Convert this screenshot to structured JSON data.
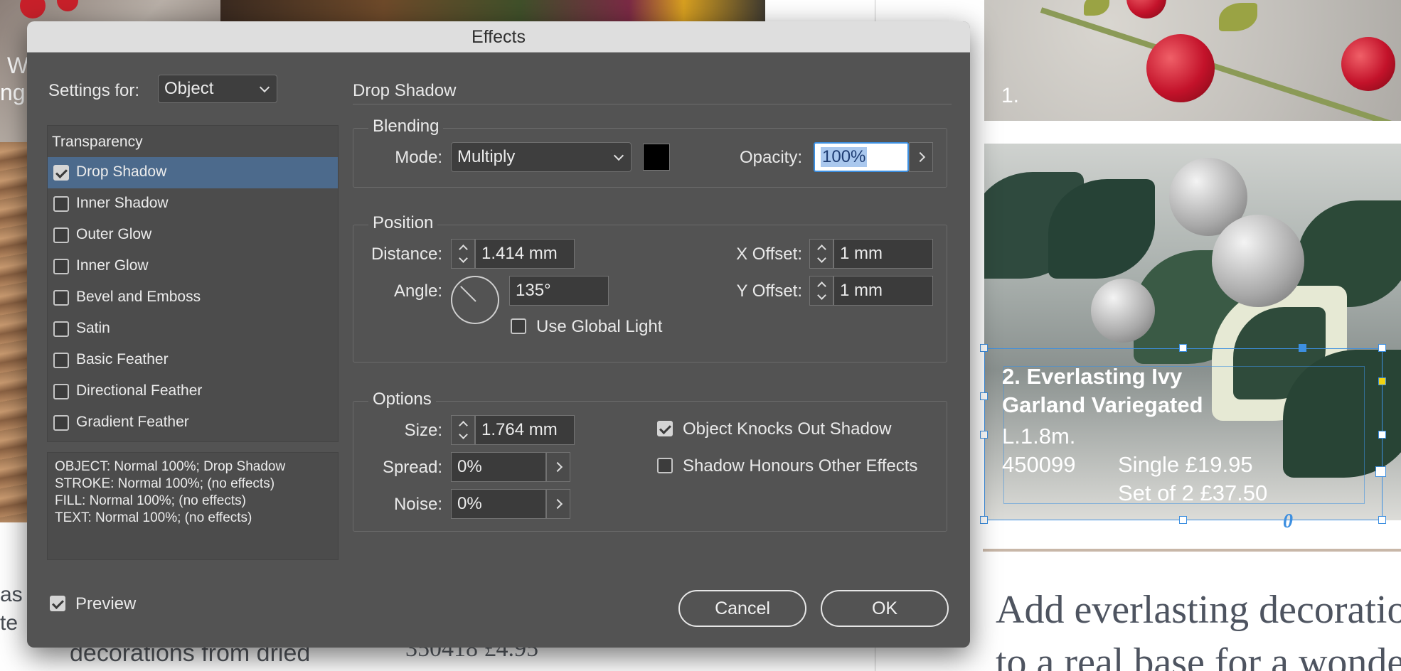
{
  "background": {
    "left_text_1": "W",
    "left_text_2": "ng",
    "left_text_3": "as",
    "left_text_4": "te",
    "bottom_left_text": "decorations from dried",
    "bottom_mid_text": "350418 £4.95",
    "top_photo_number": "1.",
    "frame_title_1": "2. Everlasting Ivy",
    "frame_title_2": "Garland Variegated",
    "frame_size": "L.1.8m.",
    "frame_code": "450099",
    "frame_price_single": "Single £19.95",
    "frame_price_set": "Set of 2 £37.50",
    "body_line_1": "Add everlasting decoratio",
    "body_line_2": "to a real base for a wonde"
  },
  "dialog": {
    "title": "Effects",
    "settings_for_label": "Settings for:",
    "settings_for_value": "Object",
    "list_header": "Transparency",
    "effects": [
      {
        "label": "Drop Shadow",
        "checked": true,
        "selected": true
      },
      {
        "label": "Inner Shadow",
        "checked": false,
        "selected": false
      },
      {
        "label": "Outer Glow",
        "checked": false,
        "selected": false
      },
      {
        "label": "Inner Glow",
        "checked": false,
        "selected": false
      },
      {
        "label": "Bevel and Emboss",
        "checked": false,
        "selected": false
      },
      {
        "label": "Satin",
        "checked": false,
        "selected": false
      },
      {
        "label": "Basic Feather",
        "checked": false,
        "selected": false
      },
      {
        "label": "Directional Feather",
        "checked": false,
        "selected": false
      },
      {
        "label": "Gradient Feather",
        "checked": false,
        "selected": false
      }
    ],
    "summary": [
      "OBJECT: Normal 100%; Drop Shadow",
      "STROKE: Normal 100%; (no effects)",
      "FILL: Normal 100%; (no effects)",
      "TEXT: Normal 100%; (no effects)"
    ],
    "section_title": "Drop Shadow",
    "blending": {
      "title": "Blending",
      "mode_label": "Mode:",
      "mode_value": "Multiply",
      "color": "#000000",
      "opacity_label": "Opacity:",
      "opacity_value": "100%"
    },
    "position": {
      "title": "Position",
      "distance_label": "Distance:",
      "distance_value": "1.414 mm",
      "angle_label": "Angle:",
      "angle_value": "135°",
      "global_light_label": "Use Global Light",
      "x_offset_label": "X Offset:",
      "x_offset_value": "1 mm",
      "y_offset_label": "Y Offset:",
      "y_offset_value": "1 mm"
    },
    "options": {
      "title": "Options",
      "size_label": "Size:",
      "size_value": "1.764 mm",
      "spread_label": "Spread:",
      "spread_value": "0%",
      "noise_label": "Noise:",
      "noise_value": "0%",
      "knockout_label": "Object Knocks Out Shadow",
      "honours_label": "Shadow Honours Other Effects"
    },
    "preview_label": "Preview",
    "cancel_label": "Cancel",
    "ok_label": "OK"
  },
  "colors": {
    "dialog_bg": "#535353",
    "selection": "#4c6a8c",
    "frame_blue": "#3d8fe0"
  }
}
